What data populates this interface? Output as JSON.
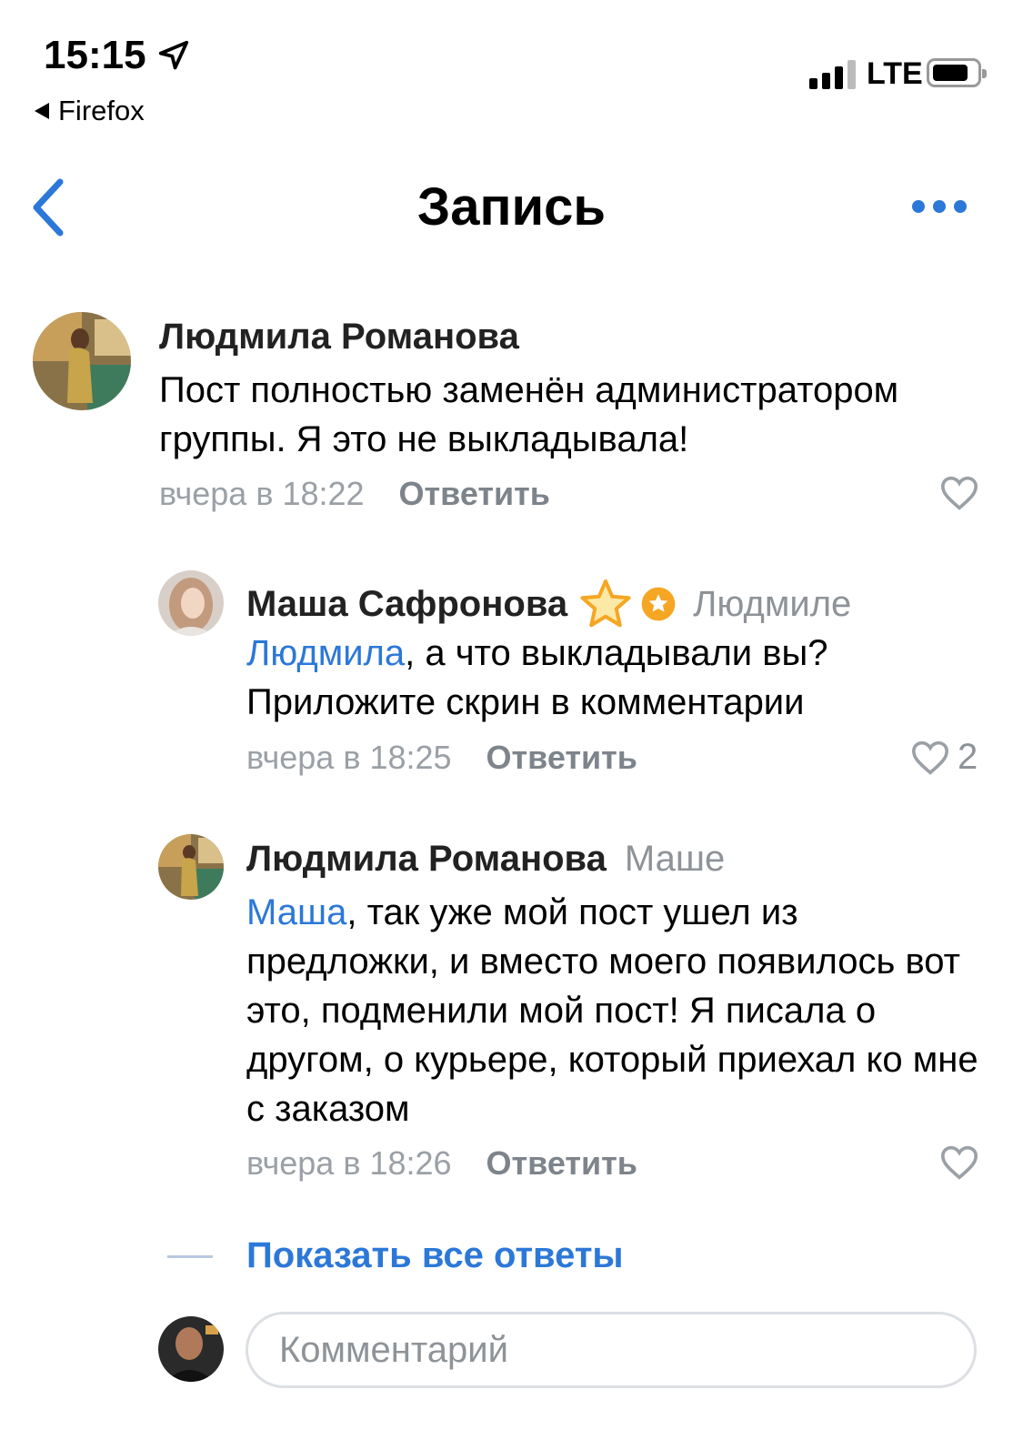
{
  "status_bar": {
    "time": "15:15",
    "back_app": "Firefox",
    "network": "LTE"
  },
  "nav": {
    "title": "Запись"
  },
  "comments": [
    {
      "author": "Людмила Романова",
      "reply_to": "",
      "mention": "",
      "text": "Пост полностью заменён администратором группы. Я это не выкладывала!",
      "time": "вчера в 18:22",
      "reply_label": "Ответить",
      "likes": ""
    },
    {
      "author": "Маша Сафронова",
      "reply_to": "Людмиле",
      "mention": "Людмила",
      "text": ", а что выкладывали вы? Приложите скрин в комментарии",
      "time": "вчера в 18:25",
      "reply_label": "Ответить",
      "likes": "2"
    },
    {
      "author": "Людмила Романова",
      "reply_to": "Маше",
      "mention": "Маша",
      "text": ", так уже мой пост ушел из предложки, и вместо моего появилось вот это, подменили мой пост! Я писала о другом, о курьере, который приехал ко мне с заказом",
      "time": "вчера в 18:26",
      "reply_label": "Ответить",
      "likes": ""
    }
  ],
  "show_all_replies": "Показать все ответы",
  "comment_input": {
    "placeholder": "Комментарий",
    "value": ""
  },
  "colors": {
    "accent": "#2c78d8",
    "secondary_text": "#9aa0a6",
    "star": "#f5a623"
  },
  "icons": [
    "location-arrow-icon",
    "back-chevron-icon",
    "more-dots-icon",
    "heart-icon",
    "star-badge-icon"
  ]
}
